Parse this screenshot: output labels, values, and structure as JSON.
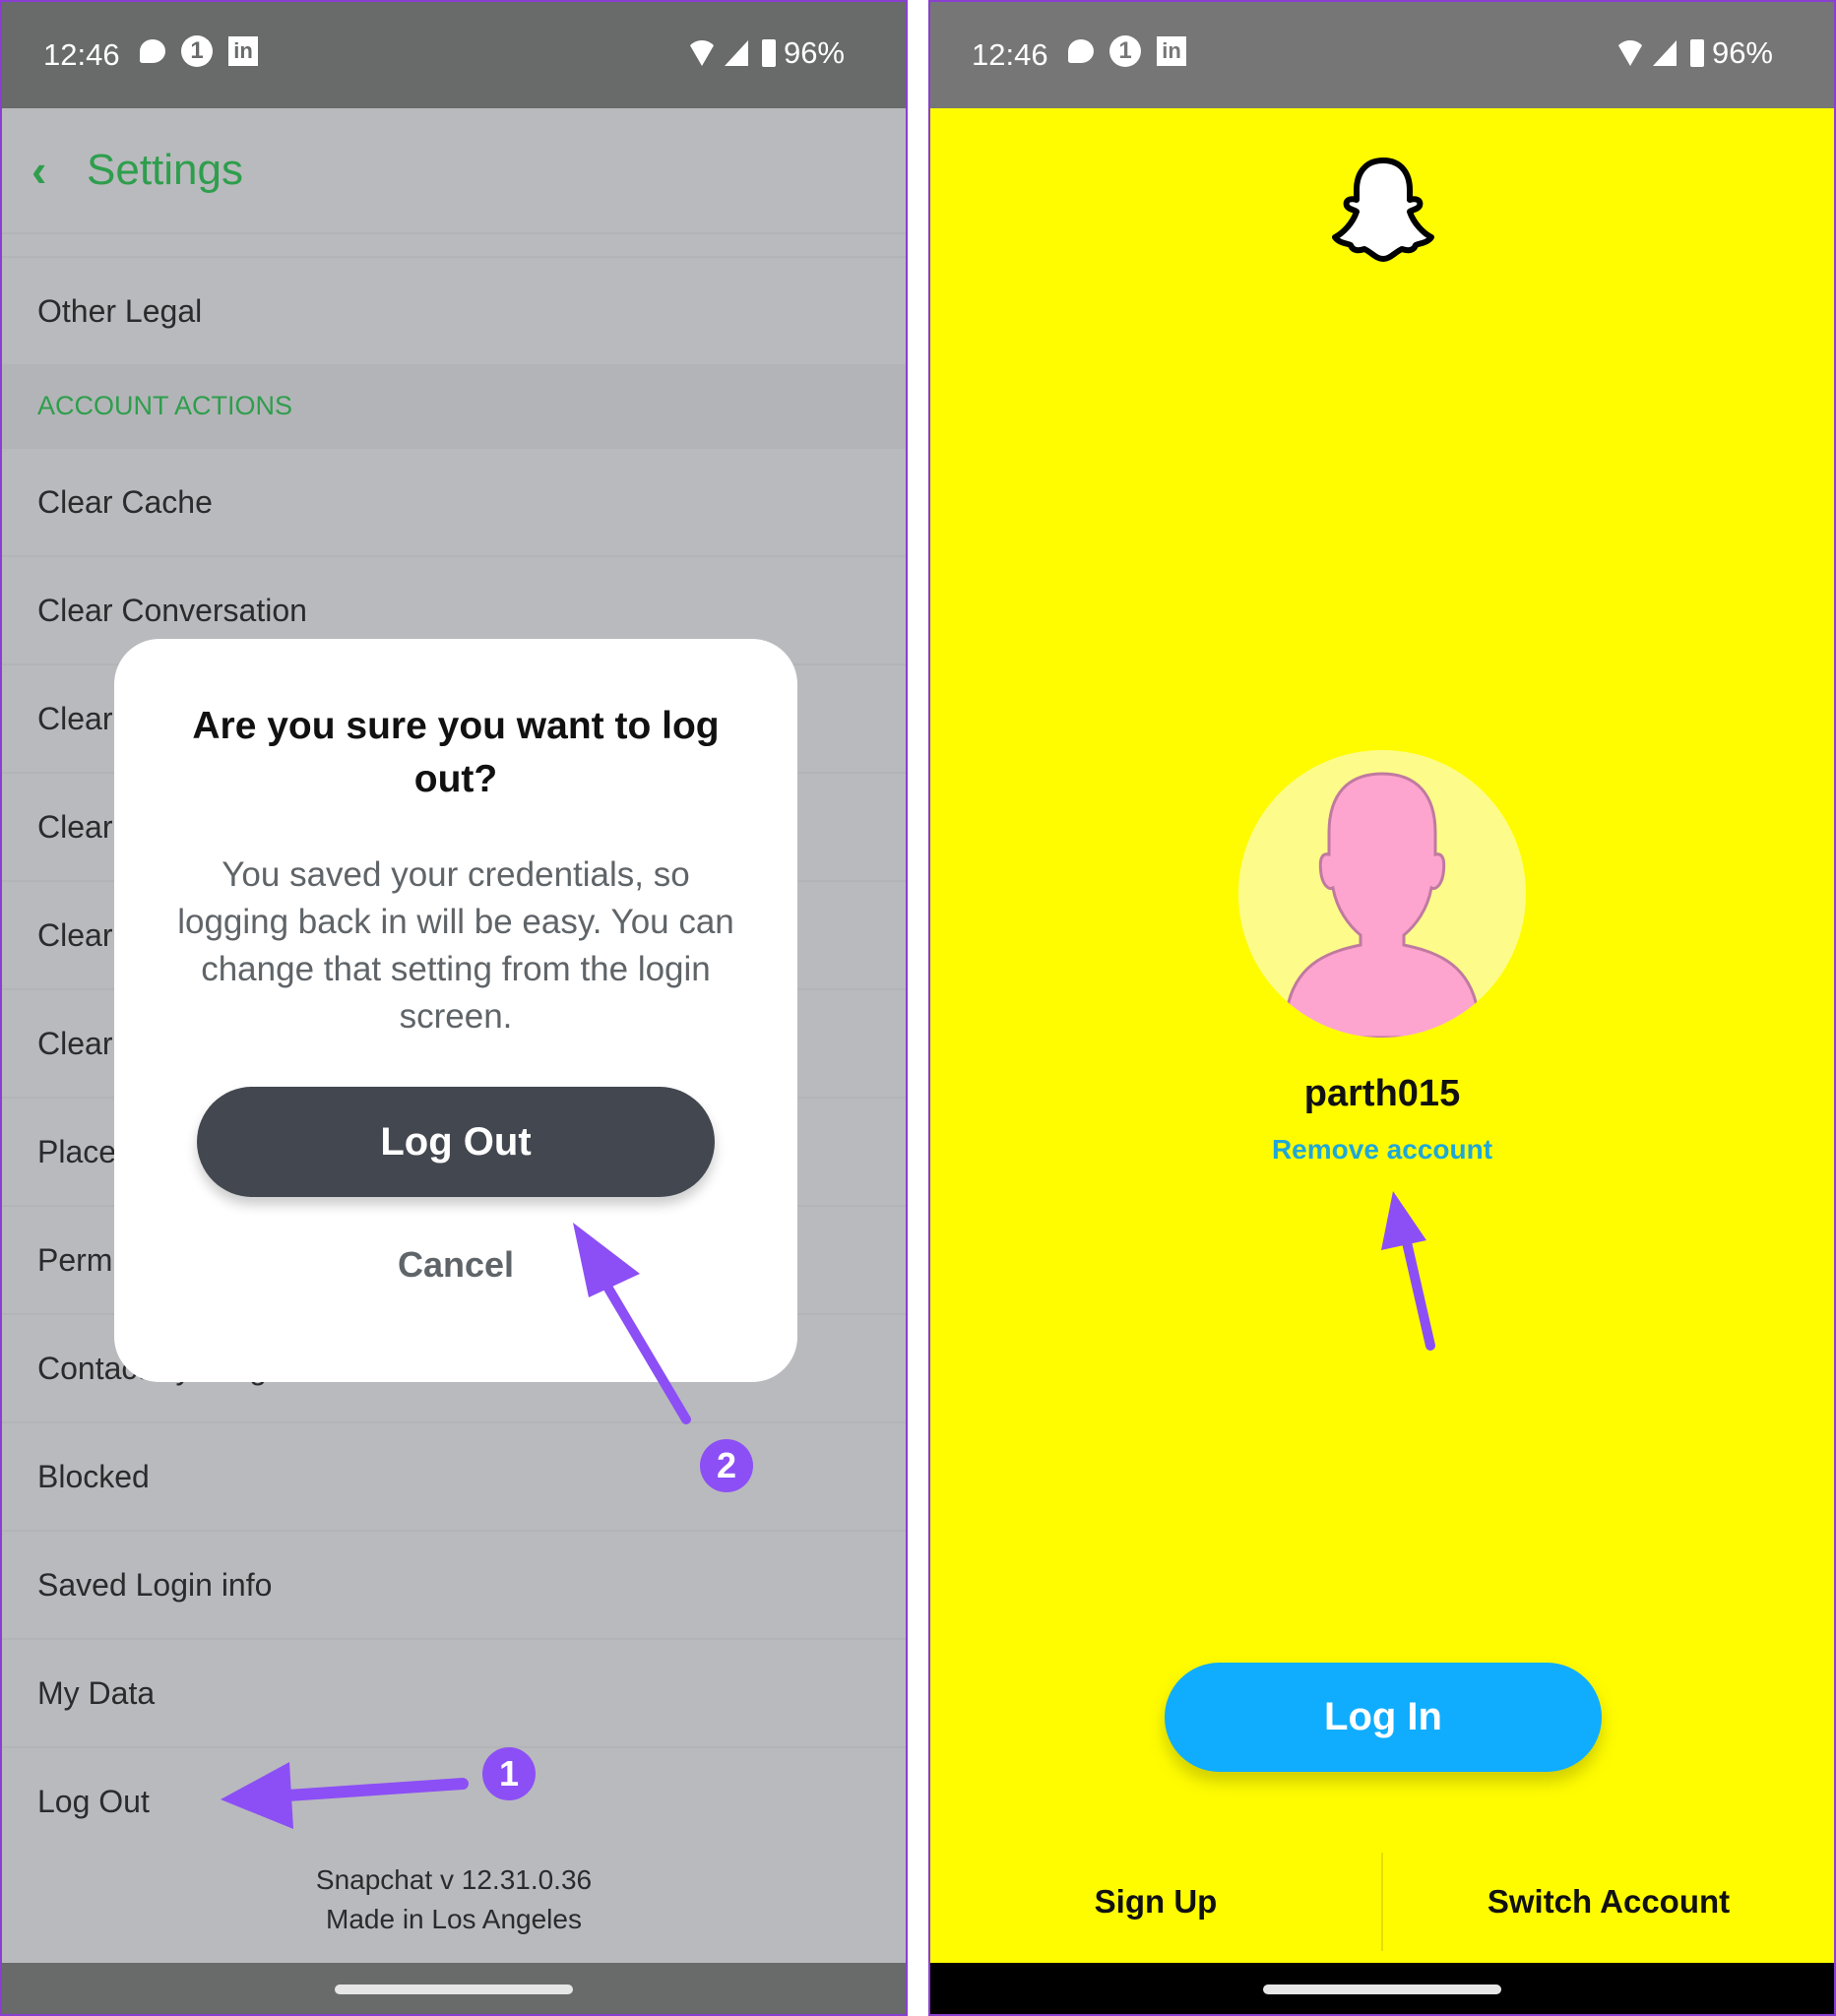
{
  "status_bar": {
    "time": "12:46",
    "battery": "96%",
    "notification_badge": "1",
    "linkedin_label": "in"
  },
  "left_screen": {
    "header": {
      "back_icon": "‹",
      "title": "Settings"
    },
    "items_top": [
      "Other Legal"
    ],
    "section_header": "ACCOUNT ACTIONS",
    "items": [
      "Clear Cache",
      "Clear Conversation",
      "Clear",
      "Clear",
      "Clear",
      "Clear",
      "Place",
      "Perm",
      "Contact Syncing",
      "Blocked",
      "Saved Login info",
      "My Data",
      "Log Out"
    ],
    "footer": {
      "version": "Snapchat v 12.31.0.36",
      "made_in": "Made in Los Angeles"
    },
    "dialog": {
      "title": "Are you sure you want to log out?",
      "body": "You saved your credentials, so logging back in will be easy. You can change that setting from the login screen.",
      "confirm_label": "Log Out",
      "cancel_label": "Cancel"
    },
    "annotations": {
      "step1": "1",
      "step2": "2"
    }
  },
  "right_screen": {
    "username": "parth015",
    "remove_account_label": "Remove account",
    "login_label": "Log In",
    "signup_label": "Sign Up",
    "switch_account_label": "Switch Account"
  },
  "colors": {
    "snap_yellow": "#fffc00",
    "settings_green": "#2e9e4d",
    "login_blue": "#10adff",
    "annotation_purple": "#8c4ff5",
    "remove_link": "#1ea8d8"
  }
}
